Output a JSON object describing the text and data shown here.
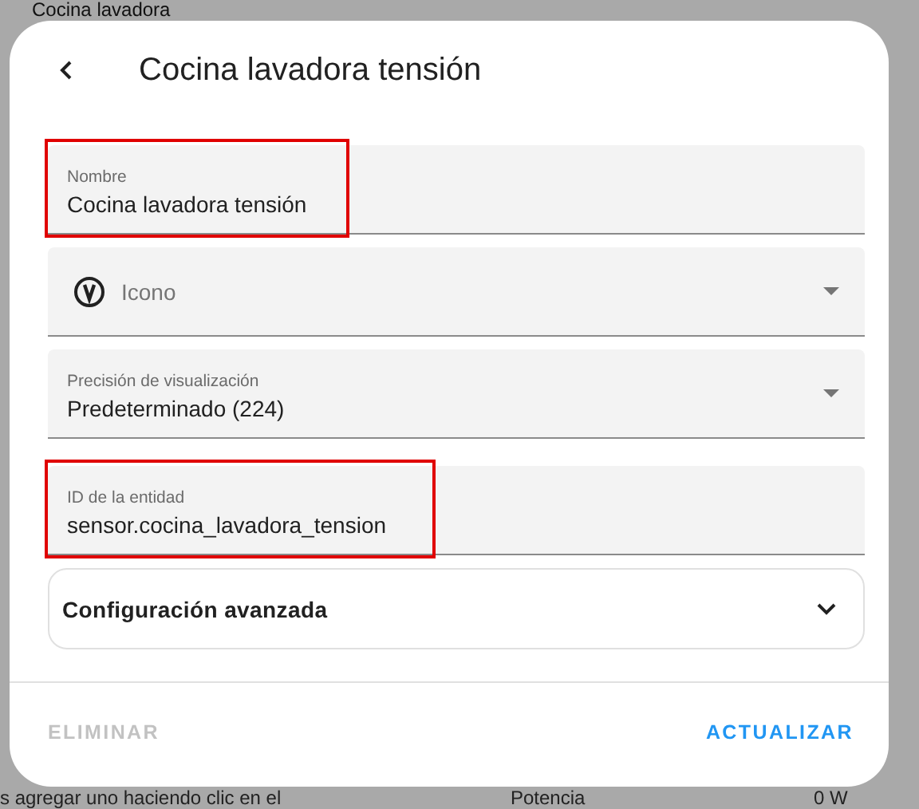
{
  "background": {
    "title": "Cocina lavadora",
    "text": "s agregar uno haciendo clic en el",
    "row": {
      "label": "Potencia",
      "value": "0 W"
    }
  },
  "dialog": {
    "title": "Cocina lavadora tensión",
    "fields": [
      {
        "kind": "text",
        "label": "Nombre",
        "value": "Cocina lavadora tensión",
        "highlighted": true
      },
      {
        "kind": "icon-select",
        "placeholder": "Icono",
        "highlighted": false
      },
      {
        "kind": "select",
        "label": "Precisión de visualización",
        "value": "Predeterminado (224)",
        "highlighted": false
      },
      {
        "kind": "text",
        "label": "ID de la entidad",
        "value": "sensor.cocina_lavadora_tension",
        "highlighted": true
      }
    ],
    "advanced": {
      "label": "Configuración avanzada",
      "expanded": false
    },
    "buttons": [
      {
        "label": "ELIMINAR",
        "disabled": true
      },
      {
        "label": "ACTUALIZAR",
        "disabled": false
      }
    ]
  }
}
